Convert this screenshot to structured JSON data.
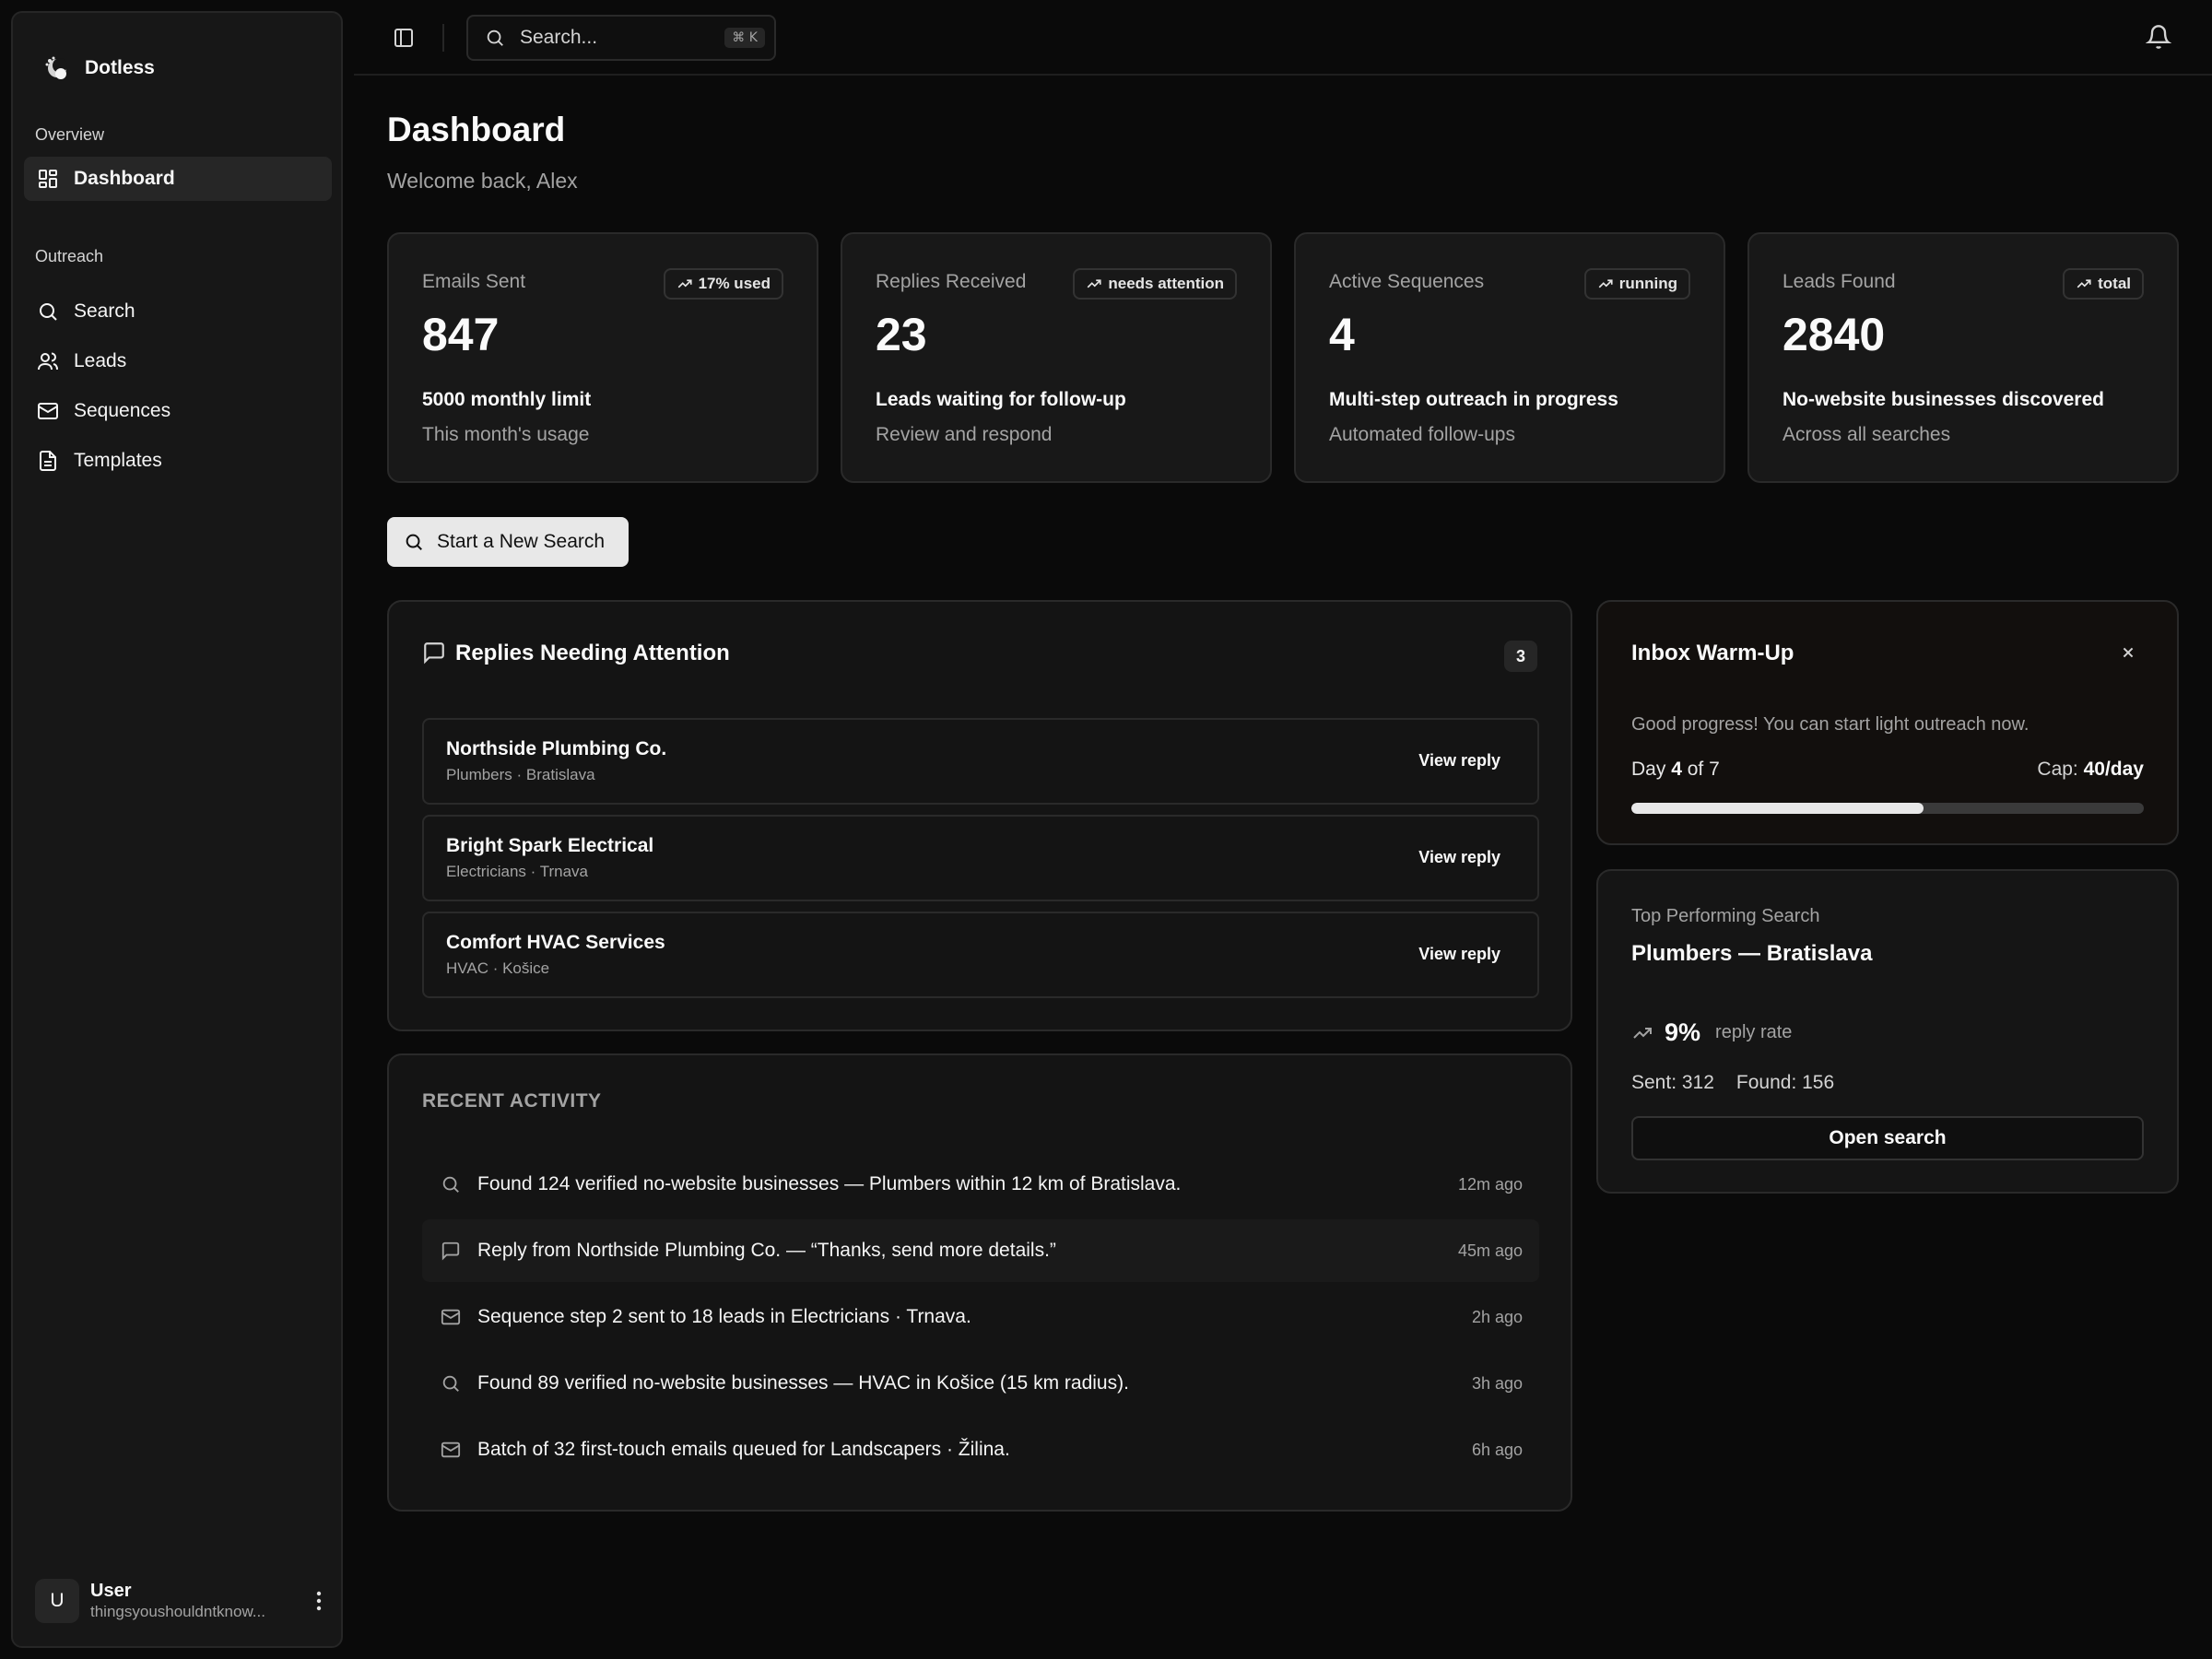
{
  "brand": {
    "name": "Dotless",
    "icon": "dotless-logo-icon"
  },
  "sidebar": {
    "sections": [
      {
        "label": "Overview"
      },
      {
        "label": "Outreach"
      }
    ],
    "items": [
      {
        "label": "Dashboard",
        "icon": "dashboard-grid-icon",
        "active": true
      },
      {
        "label": "Search",
        "icon": "search-icon"
      },
      {
        "label": "Leads",
        "icon": "users-icon"
      },
      {
        "label": "Sequences",
        "icon": "mail-icon"
      },
      {
        "label": "Templates",
        "icon": "document-icon"
      }
    ],
    "user": {
      "initial": "U",
      "name": "User",
      "email": "thingsyoushouldntknow..."
    }
  },
  "topbar": {
    "search_placeholder": "Search...",
    "shortcut": "⌘ K"
  },
  "page": {
    "title": "Dashboard",
    "subtitle": "Welcome back, Alex"
  },
  "stats": [
    {
      "label": "Emails Sent",
      "badge": "17% used",
      "value": "847",
      "desc": "5000 monthly limit",
      "foot": "This month's usage"
    },
    {
      "label": "Replies Received",
      "badge": "needs attention",
      "value": "23",
      "desc": "Leads waiting for follow-up",
      "foot": "Review and respond"
    },
    {
      "label": "Active Sequences",
      "badge": "running",
      "value": "4",
      "desc": "Multi-step outreach in progress",
      "foot": "Automated follow-ups"
    },
    {
      "label": "Leads Found",
      "badge": "total",
      "value": "2840",
      "desc": "No-website businesses discovered",
      "foot": "Across all searches"
    }
  ],
  "cta": {
    "label": "Start a New Search"
  },
  "replies": {
    "title": "Replies Needing Attention",
    "count": "3",
    "items": [
      {
        "name": "Northside Plumbing Co.",
        "meta": "Plumbers · Bratislava",
        "action": "View reply"
      },
      {
        "name": "Bright Spark Electrical",
        "meta": "Electricians · Trnava",
        "action": "View reply"
      },
      {
        "name": "Comfort HVAC Services",
        "meta": "HVAC · Košice",
        "action": "View reply"
      }
    ]
  },
  "activity": {
    "title": "RECENT ACTIVITY",
    "items": [
      {
        "icon": "search-icon",
        "text": "Found 124 verified no-website businesses — Plumbers within 12 km of Bratislava.",
        "time": "12m ago"
      },
      {
        "icon": "message-icon",
        "text": "Reply from Northside Plumbing Co. — “Thanks, send more details.”",
        "time": "45m ago"
      },
      {
        "icon": "mail-icon",
        "text": "Sequence step 2 sent to 18 leads in Electricians · Trnava.",
        "time": "2h ago"
      },
      {
        "icon": "search-icon",
        "text": "Found 89 verified no-website businesses — HVAC in Košice (15 km radius).",
        "time": "3h ago"
      },
      {
        "icon": "mail-icon",
        "text": "Batch of 32 first-touch emails queued for Landscapers · Žilina.",
        "time": "6h ago"
      }
    ]
  },
  "warmup": {
    "title": "Inbox Warm-Up",
    "message": "Good progress! You can start light outreach now.",
    "day_prefix": "Day",
    "day": "4",
    "day_of": "of 7",
    "cap_label": "Cap:",
    "cap_value": "40/day",
    "progress": 0.57
  },
  "top_search": {
    "label": "Top Performing Search",
    "title": "Plumbers — Bratislava",
    "rate": "9%",
    "rate_label": "reply rate",
    "sent": "Sent: 312",
    "found": "Found: 156",
    "button": "Open search"
  }
}
